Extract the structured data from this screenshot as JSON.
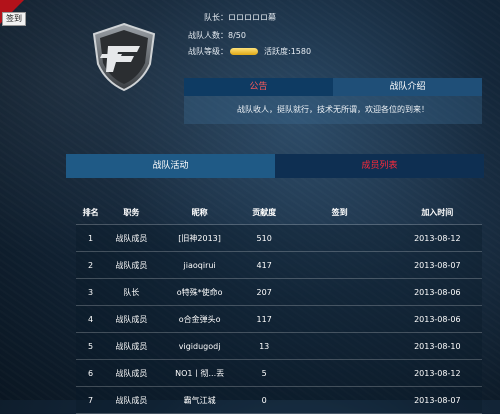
{
  "corner_tag": "签到",
  "team_info": {
    "leader": "队长：ロロロロロ幕",
    "member_count": "战队人数：8/50",
    "level_label": "战队等级：",
    "activity": "活跃度:1580"
  },
  "top_tabs": {
    "notice": "公告",
    "intro": "战队介绍"
  },
  "notice_text": "战队收人，挺队就行，技术无所谓，欢迎各位的到来！",
  "mid_tabs": {
    "activity": "战队活动",
    "members": "成员列表"
  },
  "table": {
    "headers": [
      "排名",
      "职务",
      "昵称",
      "贡献度",
      "签到",
      "加入时间"
    ],
    "rows": [
      {
        "rank": "1",
        "role": "战队成员",
        "nick": "[旧神2013]",
        "contrib": "510",
        "sign": "",
        "date": "2013-08-12"
      },
      {
        "rank": "2",
        "role": "战队成员",
        "nick": "jiaoqirui",
        "contrib": "417",
        "sign": "",
        "date": "2013-08-07"
      },
      {
        "rank": "3",
        "role": "队长",
        "nick": "o特殊*使命o",
        "contrib": "207",
        "sign": "",
        "date": "2013-08-06"
      },
      {
        "rank": "4",
        "role": "战队成员",
        "nick": "o合金弹头o",
        "contrib": "117",
        "sign": "",
        "date": "2013-08-06"
      },
      {
        "rank": "5",
        "role": "战队成员",
        "nick": "vigidugodj",
        "contrib": "13",
        "sign": "",
        "date": "2013-08-10"
      },
      {
        "rank": "6",
        "role": "战队成员",
        "nick": "NO1丨彻...丟",
        "contrib": "5",
        "sign": "",
        "date": "2013-08-12"
      },
      {
        "rank": "7",
        "role": "战队成员",
        "nick": "霸气江城",
        "contrib": "0",
        "sign": "",
        "date": "2013-08-07"
      }
    ]
  }
}
